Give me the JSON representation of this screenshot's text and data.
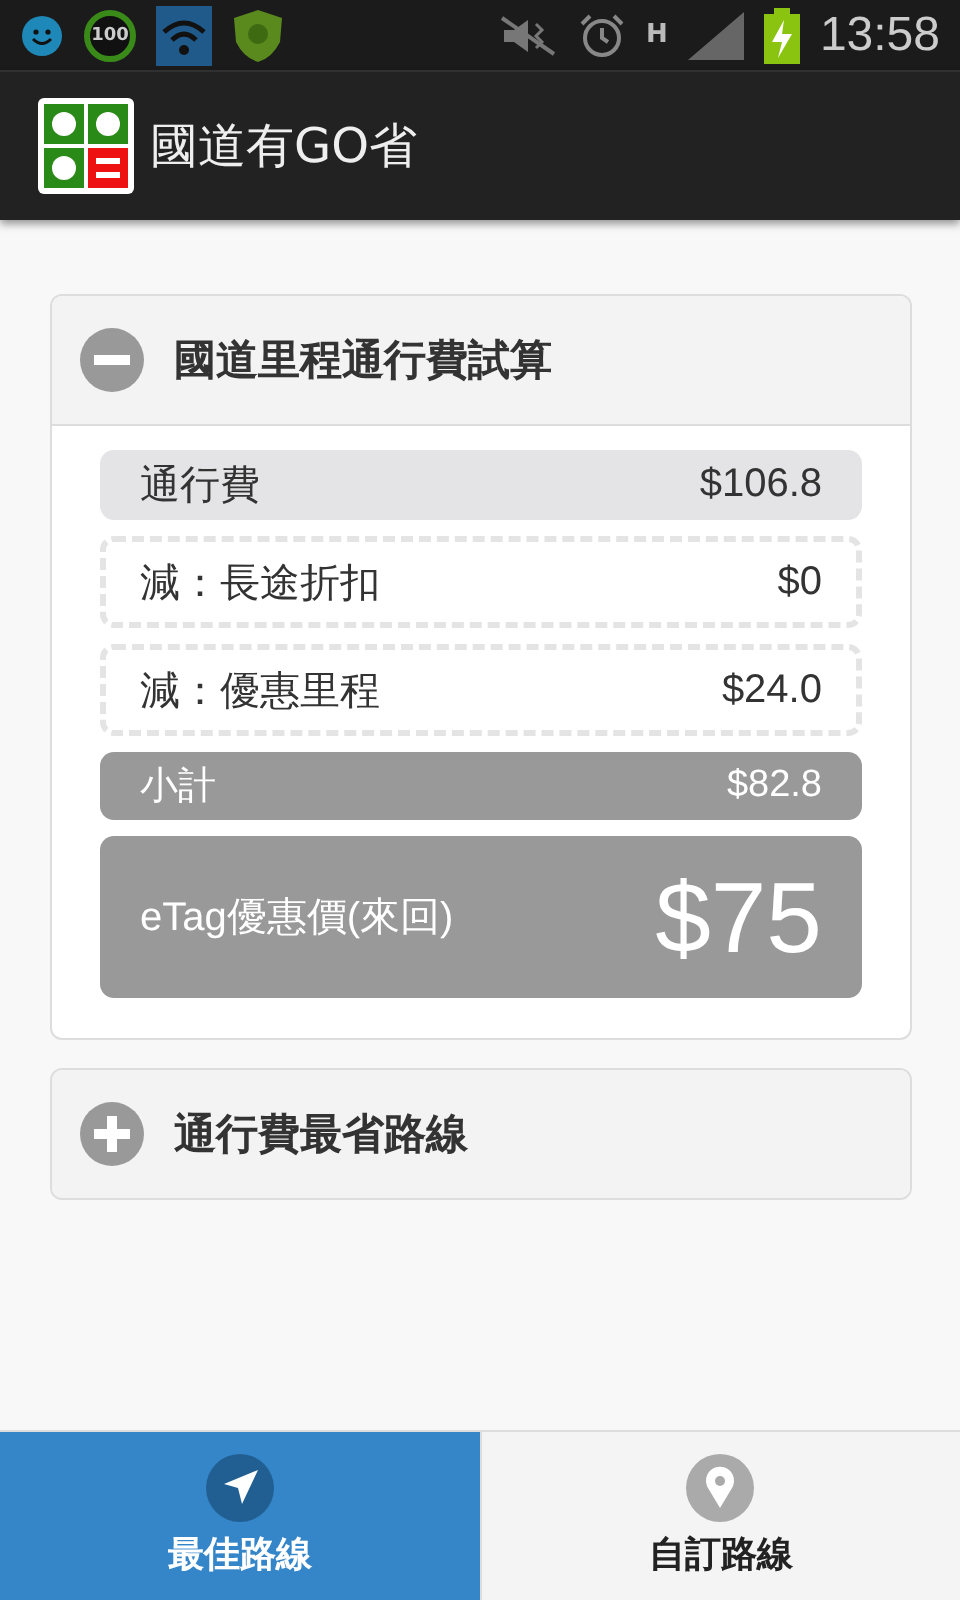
{
  "status_bar": {
    "battery_badge": "100",
    "network_type": "H",
    "time": "13:58",
    "battery_charging": true
  },
  "app_bar": {
    "title": "國道有GO省"
  },
  "sections": [
    {
      "title": "國道里程通行費試算",
      "expanded": true,
      "rows": [
        {
          "kind": "fee",
          "label": "通行費",
          "value": "$106.8"
        },
        {
          "kind": "discount",
          "label": "減：長途折扣",
          "value": "$0"
        },
        {
          "kind": "discount",
          "label": "減：優惠里程",
          "value": "$24.0"
        },
        {
          "kind": "subtotal",
          "label": "小計",
          "value": "$82.8"
        },
        {
          "kind": "total",
          "label": "eTag優惠價(來回)",
          "value": "$75"
        }
      ]
    },
    {
      "title": "通行費最省路線",
      "expanded": false
    }
  ],
  "tabs": [
    {
      "label": "最佳路線",
      "kind": "navigate",
      "selected": true
    },
    {
      "label": "自訂路線",
      "kind": "pin",
      "selected": false
    }
  ]
}
